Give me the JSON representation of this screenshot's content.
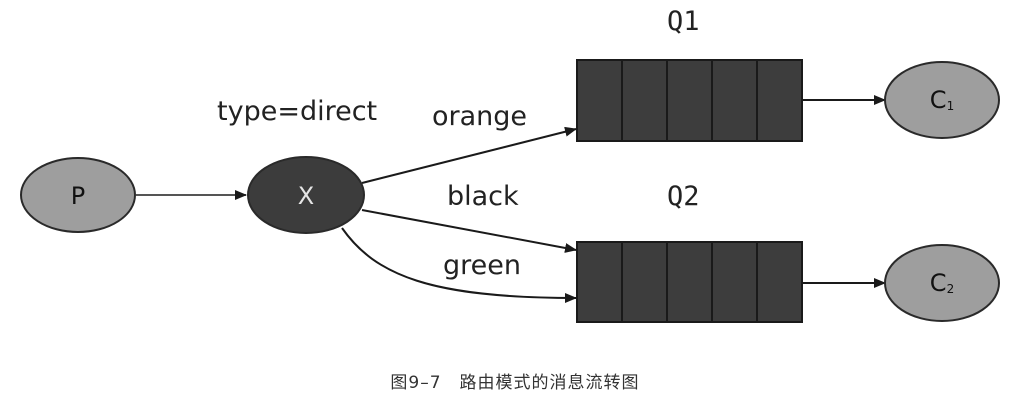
{
  "diagram": {
    "exchange_type_label": "type=direct",
    "producer": {
      "label": "P"
    },
    "exchange": {
      "label": "X"
    },
    "queues": [
      {
        "name": "Q1",
        "consumer": {
          "base": "C",
          "sub": "1"
        }
      },
      {
        "name": "Q2",
        "consumer": {
          "base": "C",
          "sub": "2"
        }
      }
    ],
    "bindings": [
      "orange",
      "black",
      "green"
    ],
    "colors": {
      "light_node": "#9e9e9e",
      "dark_node": "#3c3c3c",
      "queue_fill": "#3d3d3d",
      "line": "#1a1a1a"
    }
  },
  "caption": "图9–7　路由模式的消息流转图"
}
